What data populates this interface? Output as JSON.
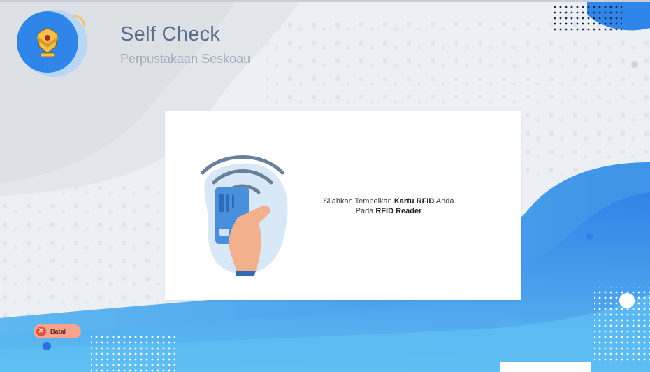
{
  "header": {
    "title": "Self Check",
    "subtitle": "Perpustakaan Seskoau"
  },
  "card": {
    "message_prefix": "Silahkan Tempelkan ",
    "message_bold1": "Kartu RFID",
    "message_mid": " Anda",
    "message_line2_prefix": "Pada ",
    "message_bold2": "RFID Reader"
  },
  "cancel_button": {
    "label": "Batal",
    "icon": "close-circle-icon"
  },
  "colors": {
    "accent_blue": "#2f86e8",
    "light_blue": "#5ab0f0",
    "cancel_bg": "#f7a38f",
    "title": "#5b6f8c"
  }
}
